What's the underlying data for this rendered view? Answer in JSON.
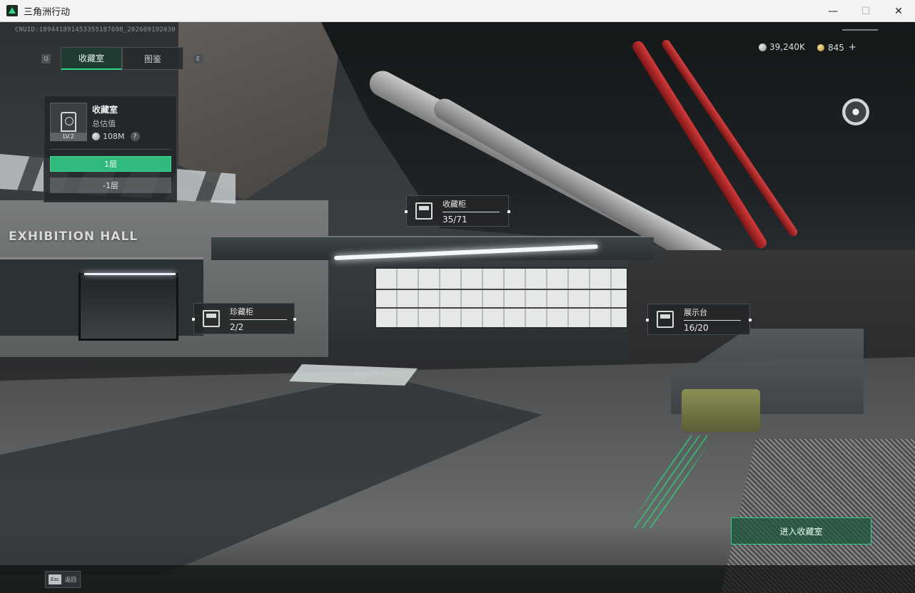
{
  "window": {
    "title": "三角洲行动",
    "minimize": "—",
    "maximize": "☐",
    "close": "✕"
  },
  "hud": {
    "cnuid": "CNUID:1894418914533551876​98_202609192030",
    "tabs": [
      {
        "label": "收藏室",
        "active": true
      },
      {
        "label": "图鉴",
        "active": false
      }
    ],
    "tab_key_left": "Q",
    "tab_key_right": "E",
    "currency": {
      "silver": "39,240K",
      "gold": "845",
      "plus": "+"
    }
  },
  "info_panel": {
    "title": "收藏室",
    "level": "LV.2",
    "subtitle": "总估值",
    "value": "108M",
    "help": "?",
    "floors": [
      {
        "label": "1层",
        "active": true
      },
      {
        "label": "-1层",
        "active": false
      }
    ]
  },
  "scene": {
    "hall_sign": "EXHIBITION HALL"
  },
  "markers": {
    "collect": {
      "title": "收藏柜",
      "count": "35/71",
      "icon": "cabinet-icon"
    },
    "treasure": {
      "title": "珍藏柜",
      "count": "2/2",
      "icon": "vault-icon"
    },
    "display": {
      "title": "展示台",
      "count": "16/20",
      "icon": "display-stand-icon"
    }
  },
  "actions": {
    "enter": "进入收藏室",
    "esc_key": "Esc",
    "esc_label": "返回"
  },
  "colors": {
    "accent": "#2fd38a",
    "accent_dark": "#2fb97c"
  }
}
